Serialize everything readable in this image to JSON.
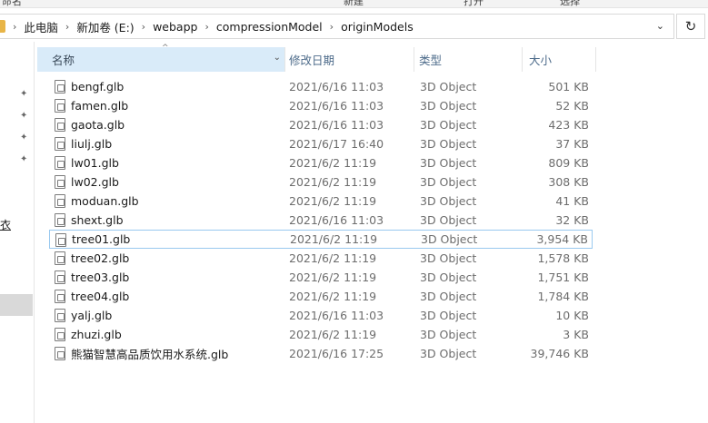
{
  "ribbon": {
    "labels": [
      "命名",
      "新建",
      "打开",
      "选择"
    ]
  },
  "address": {
    "crumbs": [
      "此电脑",
      "新加卷 (E:)",
      "webapp",
      "compressionModel",
      "originModels"
    ],
    "separator": "›",
    "dropdown_glyph": "⌄",
    "refresh_glyph": "↻"
  },
  "nav": {
    "pin_glyph": "✦",
    "link_char": "衣"
  },
  "columns": {
    "name": "名称",
    "date": "修改日期",
    "type": "类型",
    "size": "大小",
    "sort_glyph": "^",
    "dropdown_glyph": "⌄"
  },
  "files": [
    {
      "name": "bengf.glb",
      "date": "2021/6/16 11:03",
      "type": "3D Object",
      "size": "501 KB"
    },
    {
      "name": "famen.glb",
      "date": "2021/6/16 11:03",
      "type": "3D Object",
      "size": "52 KB"
    },
    {
      "name": "gaota.glb",
      "date": "2021/6/16 11:03",
      "type": "3D Object",
      "size": "423 KB"
    },
    {
      "name": "liulj.glb",
      "date": "2021/6/17 16:40",
      "type": "3D Object",
      "size": "37 KB"
    },
    {
      "name": "lw01.glb",
      "date": "2021/6/2 11:19",
      "type": "3D Object",
      "size": "809 KB"
    },
    {
      "name": "lw02.glb",
      "date": "2021/6/2 11:19",
      "type": "3D Object",
      "size": "308 KB"
    },
    {
      "name": "moduan.glb",
      "date": "2021/6/2 11:19",
      "type": "3D Object",
      "size": "41 KB"
    },
    {
      "name": "shext.glb",
      "date": "2021/6/16 11:03",
      "type": "3D Object",
      "size": "32 KB"
    },
    {
      "name": "tree01.glb",
      "date": "2021/6/2 11:19",
      "type": "3D Object",
      "size": "3,954 KB"
    },
    {
      "name": "tree02.glb",
      "date": "2021/6/2 11:19",
      "type": "3D Object",
      "size": "1,578 KB"
    },
    {
      "name": "tree03.glb",
      "date": "2021/6/2 11:19",
      "type": "3D Object",
      "size": "1,751 KB"
    },
    {
      "name": "tree04.glb",
      "date": "2021/6/2 11:19",
      "type": "3D Object",
      "size": "1,784 KB"
    },
    {
      "name": "yalj.glb",
      "date": "2021/6/16 11:03",
      "type": "3D Object",
      "size": "10 KB"
    },
    {
      "name": "zhuzi.glb",
      "date": "2021/6/2 11:19",
      "type": "3D Object",
      "size": "3 KB"
    },
    {
      "name": "熊猫智慧高品质饮用水系统.glb",
      "date": "2021/6/16 17:25",
      "type": "3D Object",
      "size": "39,746 KB"
    }
  ]
}
